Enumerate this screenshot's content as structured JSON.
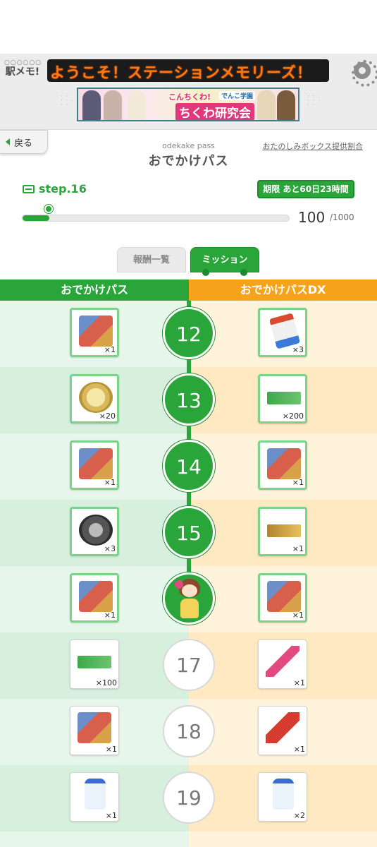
{
  "header": {
    "logo_dots": "○○○○○○",
    "logo_name": "駅メモ!",
    "ticker_text": "ようこそ！ステーションメモリーズ！",
    "banner": {
      "line1": "こんちくわ!",
      "line2": "でんこ学園",
      "line3": "ちくわ研究会"
    }
  },
  "nav": {
    "back_label": "戻る",
    "pass_en": "odekake pass",
    "pass_ja": "おでかけパス",
    "ratio_link": "おたのしみボックス提供割合"
  },
  "status": {
    "step_label": "step.16",
    "deadline": "期限 あと60日23時間",
    "progress_value": "100",
    "progress_max": "/1000",
    "progress_fraction": 0.1
  },
  "tabs": [
    {
      "label": "報酬一覧",
      "active": false
    },
    {
      "label": "ミッション",
      "active": true
    }
  ],
  "columns": {
    "free": "おでかけパス",
    "dx": "おでかけパスDX"
  },
  "rows": [
    {
      "step": "12",
      "state": "done",
      "free": {
        "icon": "lottery-cube-icon",
        "qty": "×1"
      },
      "dx": {
        "icon": "battery-icon",
        "qty": "×3"
      }
    },
    {
      "step": "13",
      "state": "done",
      "free": {
        "icon": "d-medal-icon",
        "qty": "×20"
      },
      "dx": {
        "icon": "friend-gacha-ticket-icon",
        "qty": "×200"
      }
    },
    {
      "step": "14",
      "state": "done",
      "free": {
        "icon": "lottery-cube-icon",
        "qty": "×1"
      },
      "dx": {
        "icon": "lottery-cube-icon",
        "qty": "×1"
      }
    },
    {
      "step": "15",
      "state": "done",
      "free": {
        "icon": "rare-ball-icon",
        "qty": "×3"
      },
      "dx": {
        "icon": "premium-gacha-ticket-icon",
        "qty": "×1"
      }
    },
    {
      "step": "",
      "state": "current",
      "free": {
        "icon": "lottery-cube-icon",
        "qty": "×1"
      },
      "dx": {
        "icon": "lottery-cube-icon",
        "qty": "×1"
      }
    },
    {
      "step": "17",
      "state": "todo",
      "free": {
        "icon": "friend-gacha-ticket-icon",
        "qty": "×100"
      },
      "dx": {
        "icon": "magic-wand-icon",
        "qty": "×1"
      }
    },
    {
      "step": "18",
      "state": "todo",
      "free": {
        "icon": "lottery-cube-icon",
        "qty": "×1"
      },
      "dx": {
        "icon": "toy-hammer-icon",
        "qty": "×1"
      }
    },
    {
      "step": "19",
      "state": "todo",
      "free": {
        "icon": "milk-bottle-icon",
        "qty": "×1"
      },
      "dx": {
        "icon": "milk-bottle-icon",
        "qty": "×2"
      }
    }
  ],
  "colors": {
    "accent_green": "#2aa53a",
    "accent_orange": "#f7a21b",
    "ticker_text": "#ff7a10"
  }
}
